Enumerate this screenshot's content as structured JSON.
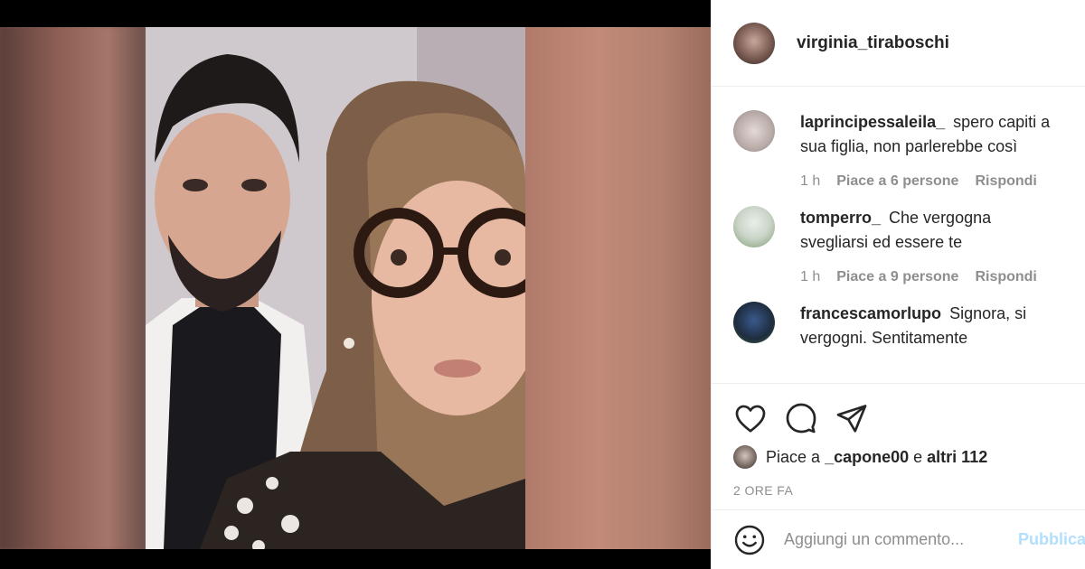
{
  "post": {
    "author": "virginia_tiraboschi"
  },
  "comments": [
    {
      "username": "laprincipessaleila_",
      "text": "spero capiti a sua figlia, non parlerebbe così",
      "time": "1 h",
      "likes": "Piace a 6 persone",
      "reply": "Rispondi"
    },
    {
      "username": "tomperro_",
      "text": "Che vergogna svegliarsi ed essere te",
      "time": "1 h",
      "likes": "Piace a 9 persone",
      "reply": "Rispondi"
    },
    {
      "username": "francescamorlupo",
      "text": "Signora, si vergogni. Sentitamente",
      "time": "",
      "likes": "",
      "reply": ""
    }
  ],
  "likes_line": {
    "prefix": "Piace a",
    "user": "_capone00",
    "connector": "e",
    "others": "altri 112"
  },
  "timestamp": "2 ORE FA",
  "comment_box": {
    "placeholder": "Aggiungi un commento...",
    "publish_label": "Pubblica"
  },
  "icons": {
    "like": "heart-icon",
    "comment": "speech-bubble-icon",
    "share": "paper-plane-icon",
    "emoji": "smiley-icon"
  },
  "colors": {
    "text": "#262626",
    "secondary": "#8e8e8e",
    "publish_disabled": "#b2dffc",
    "divider": "#efefef"
  }
}
